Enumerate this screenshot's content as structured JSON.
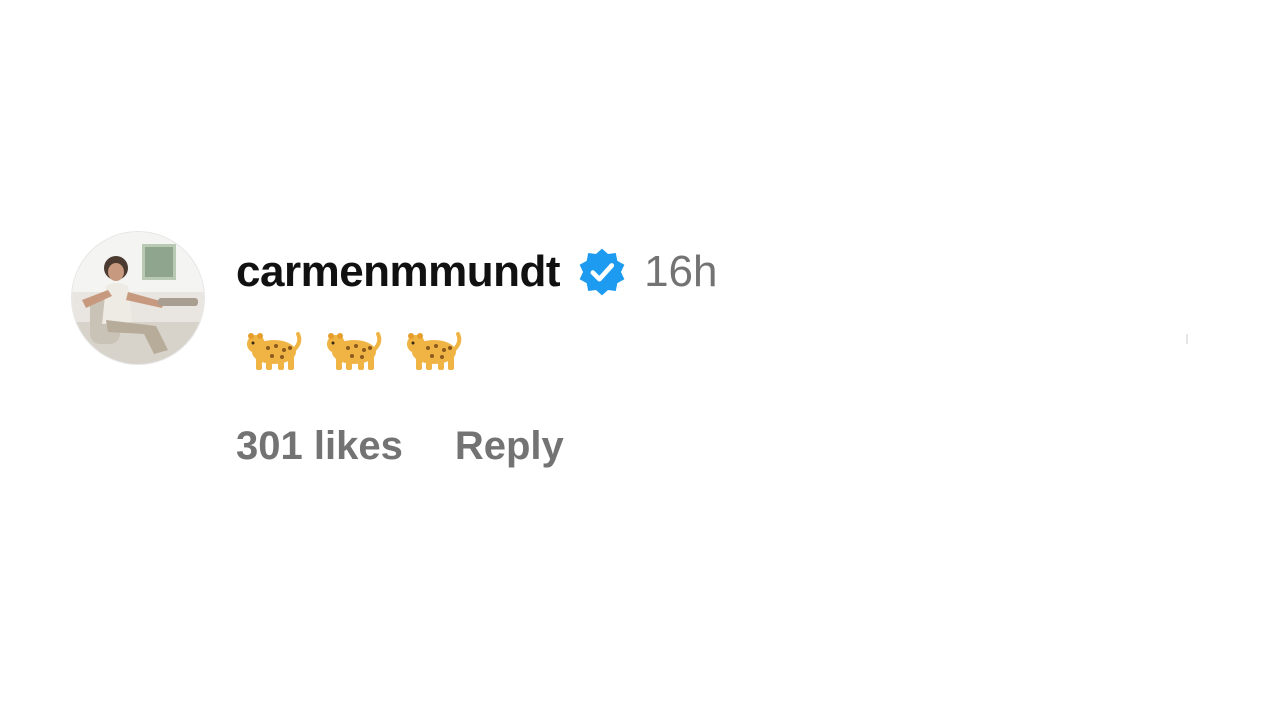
{
  "comment": {
    "username": "carmenmmundt",
    "verified_icon": "verified-badge-icon",
    "verified_color": "#1d9bf0",
    "time": "16h",
    "text": "🐆🐆🐆",
    "emoji_icons": [
      "leopard-icon",
      "leopard-icon",
      "leopard-icon"
    ],
    "likes": "301 likes",
    "reply_label": "Reply"
  }
}
